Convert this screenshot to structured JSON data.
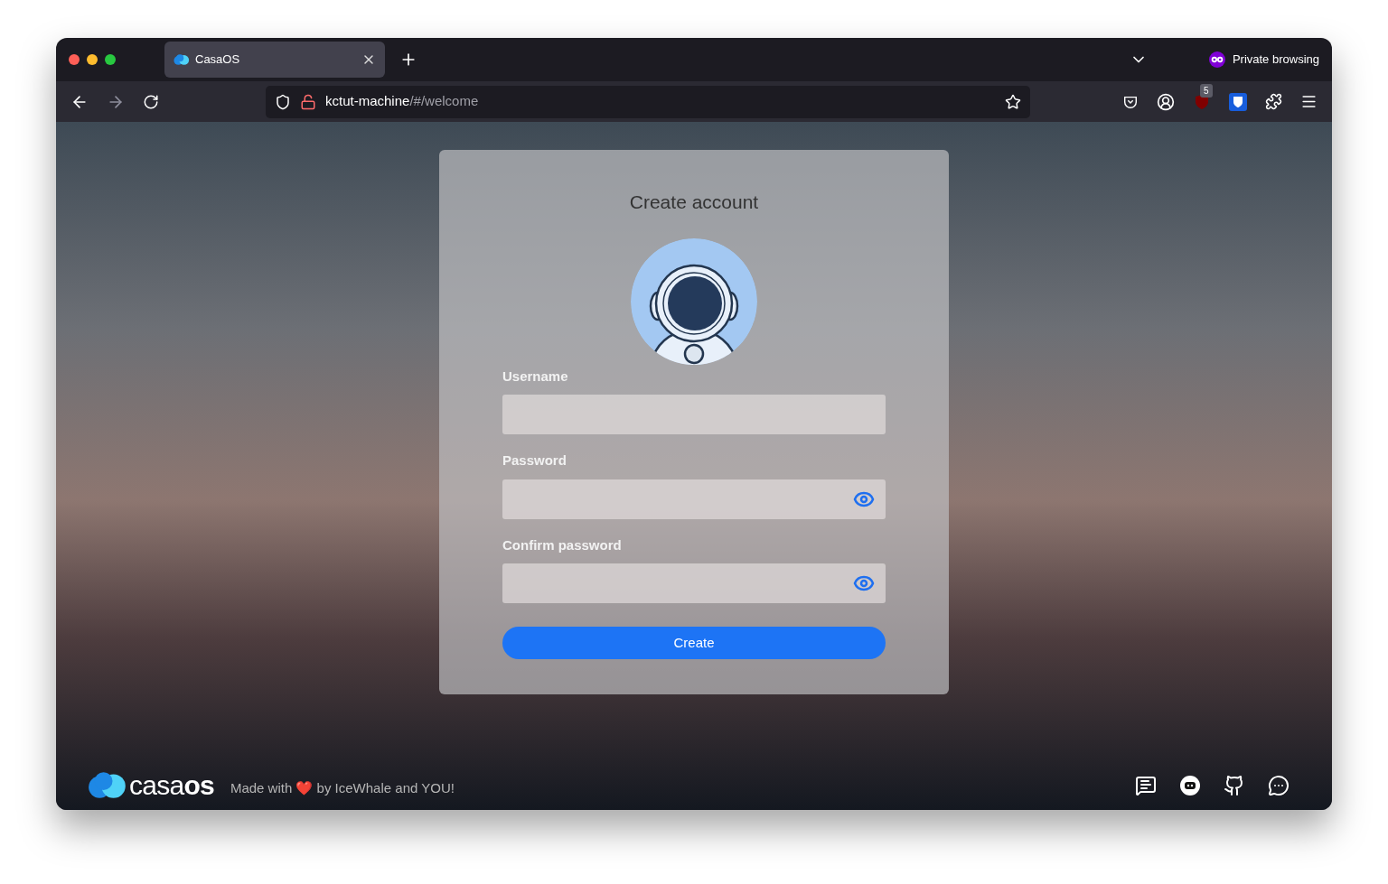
{
  "browser": {
    "tabs": [
      {
        "title": "CasaOS",
        "selected": true
      }
    ],
    "private_label": "Private browsing",
    "address": {
      "host": "kctut-machine",
      "path": "/#/welcome"
    },
    "extension_badge": "5"
  },
  "form": {
    "title": "Create account",
    "fields": [
      {
        "label": "Username",
        "kind": "text"
      },
      {
        "label": "Password",
        "kind": "password"
      },
      {
        "label": "Confirm password",
        "kind": "password"
      }
    ],
    "submit": "Create"
  },
  "footer": {
    "logo": "casa**os**",
    "tagline": "Made with ❤️ by IceWhale and YOU!"
  }
}
